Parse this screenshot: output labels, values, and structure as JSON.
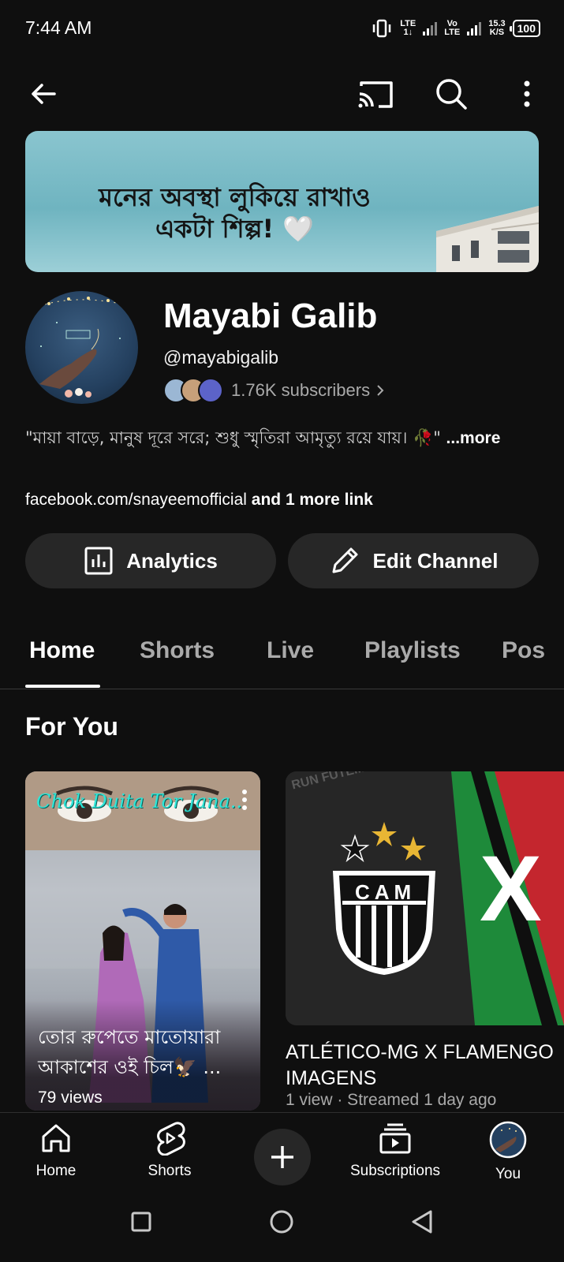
{
  "status_bar": {
    "time": "7:44 AM",
    "lte1_top": "LTE",
    "lte1_bottom": "1↓",
    "volte_top": "Vo",
    "volte_bottom": "LTE",
    "speed_top": "15.3",
    "speed_bottom": "K/S",
    "battery": "100"
  },
  "top_bar": {
    "icons": [
      "back-arrow-icon",
      "cast-icon",
      "search-icon",
      "more-vert-icon"
    ]
  },
  "banner": {
    "line1": "মনের অবস্থা লুকিয়ে রাখাও",
    "line2": "একটা শিল্প! 🤍"
  },
  "channel": {
    "name": "Mayabi Galib",
    "handle": "@mayabigalib",
    "subscribers": "1.76K subscribers",
    "description": "\"মায়া বাড়ে, মানুষ দূরে সরে; শুধু স্মৃতিরা আমৃত্যু রয়ে যায়। 🥀\"",
    "more": "...more",
    "link": "facebook.com/snayeemofficial",
    "more_links": "and 1 more link"
  },
  "actions": {
    "analytics": "Analytics",
    "edit": "Edit Channel"
  },
  "tabs": [
    "Home",
    "Shorts",
    "Live",
    "Playlists",
    "Pos"
  ],
  "active_tab": "Home",
  "section": {
    "title": "For You"
  },
  "cards": [
    {
      "overlay_text": "Chok Duita Tor Jana..",
      "title": "তোর রুপেতে মাতোয়ারা আকাশের ওই চিল🦅 ...",
      "views": "79 views"
    },
    {
      "thumb_text": "CAM",
      "thumb_x": "X",
      "watermark": "RUN FUTEMAX",
      "title_line1": "ATLÉTICO-MG X FLAMENGO",
      "title_line2": "IMAGENS",
      "meta": "1 view · Streamed 1 day ago"
    }
  ],
  "bottom_nav": {
    "home": "Home",
    "shorts": "Shorts",
    "subscriptions": "Subscriptions",
    "you": "You"
  },
  "colors": {
    "background": "#0f0f0f",
    "pill": "#272727",
    "muted_text": "#aaaaaa",
    "banner": "#7cbec9"
  }
}
